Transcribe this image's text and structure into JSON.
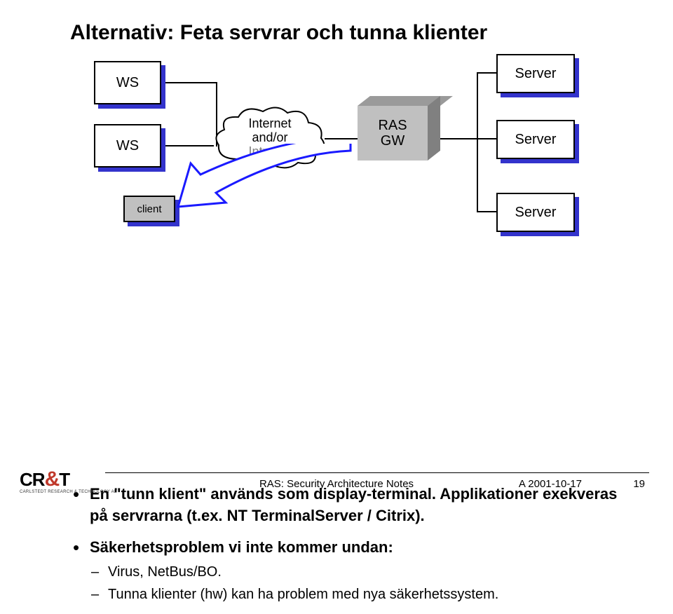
{
  "title": "Alternativ: Feta servrar och tunna klienter",
  "diagram": {
    "ws1": "WS",
    "ws2": "WS",
    "client": "client",
    "cloud_line1": "Internet",
    "cloud_line2": "and/or",
    "cloud_line3": "Intranet",
    "ras_line1": "RAS",
    "ras_line2": "GW",
    "server1": "Server",
    "server2": "Server",
    "server3": "Server"
  },
  "bullets": {
    "b1_bold": "En \"tunn klient\" används som display-terminal. Applikationer exekveras på servrarna (t.ex. NT TerminalServer / Citrix).",
    "b2_bold": "Säkerhetsproblem vi inte kommer undan:",
    "b2_sub1": "Virus, NetBus/BO.",
    "b2_sub2": "Tunna klienter (hw) kan ha problem med nya säkerhetssystem."
  },
  "footer": {
    "center": "RAS: Security Architecture Notes",
    "date": "A 2001-10-17",
    "page": "19",
    "logo_cr": "CR",
    "logo_amp": "&",
    "logo_t": "T",
    "logo_sub": "CARLSTEDT RESEARCH & TECHNOLOGY AB"
  }
}
